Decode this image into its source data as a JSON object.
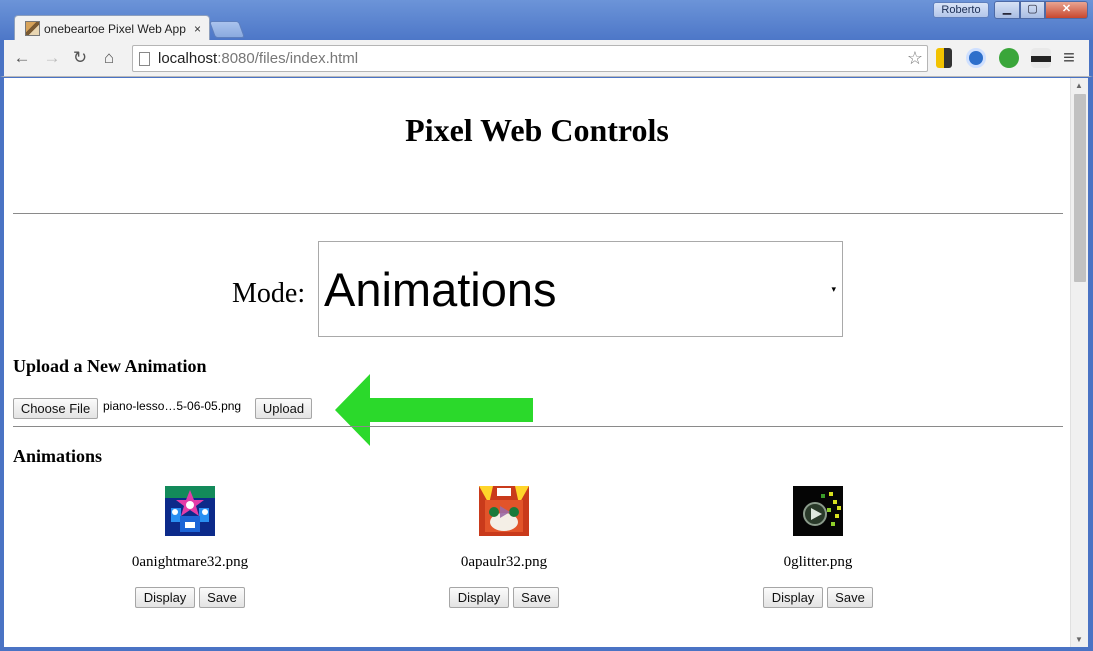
{
  "browser": {
    "tab_title": "onebeartoe Pixel Web App",
    "tab_close": "×",
    "user_name": "Roberto",
    "window_buttons": {
      "minimize": "▁",
      "maximize": "▢",
      "close": "✕"
    },
    "nav": {
      "back": "←",
      "forward": "→",
      "reload": "↻",
      "home": "⌂"
    },
    "url_host": "localhost",
    "url_rest": ":8080/files/index.html",
    "star": "☆",
    "menu": "≡"
  },
  "page": {
    "title": "Pixel Web Controls",
    "mode_label": "Mode:",
    "mode_value": "Animations",
    "mode_caret": "▾",
    "upload_heading": "Upload a New Animation",
    "choose_file_label": "Choose File",
    "chosen_file": "piano-lesso…5-06-05.png",
    "upload_label": "Upload",
    "animations_heading": "Animations",
    "animations": [
      {
        "name": "0anightmare32.png",
        "display_label": "Display",
        "save_label": "Save"
      },
      {
        "name": "0apaulr32.png",
        "display_label": "Display",
        "save_label": "Save"
      },
      {
        "name": "0glitter.png",
        "display_label": "Display",
        "save_label": "Save"
      }
    ]
  },
  "colors": {
    "highlight_arrow": "#2bd92b",
    "window_frame": "#4a73c4"
  }
}
